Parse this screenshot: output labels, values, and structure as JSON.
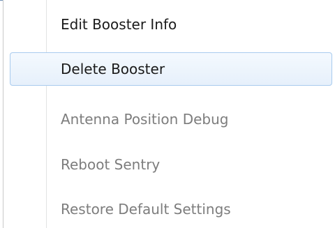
{
  "context_menu": {
    "items": [
      {
        "label": "Edit Booster Info",
        "state": "enabled",
        "highlighted": false
      },
      {
        "label": "Delete Booster",
        "state": "enabled",
        "highlighted": true
      },
      {
        "label": "Antenna Position Debug",
        "state": "disabled",
        "highlighted": false
      },
      {
        "label": "Reboot Sentry",
        "state": "disabled",
        "highlighted": false
      },
      {
        "label": "Restore Default Settings",
        "state": "disabled",
        "highlighted": false
      }
    ]
  },
  "colors": {
    "enabled_text": "#1a1a1a",
    "disabled_text": "#7d7d7d",
    "highlight_border": "#a8cbee",
    "highlight_fill": "#e6f0fb"
  }
}
